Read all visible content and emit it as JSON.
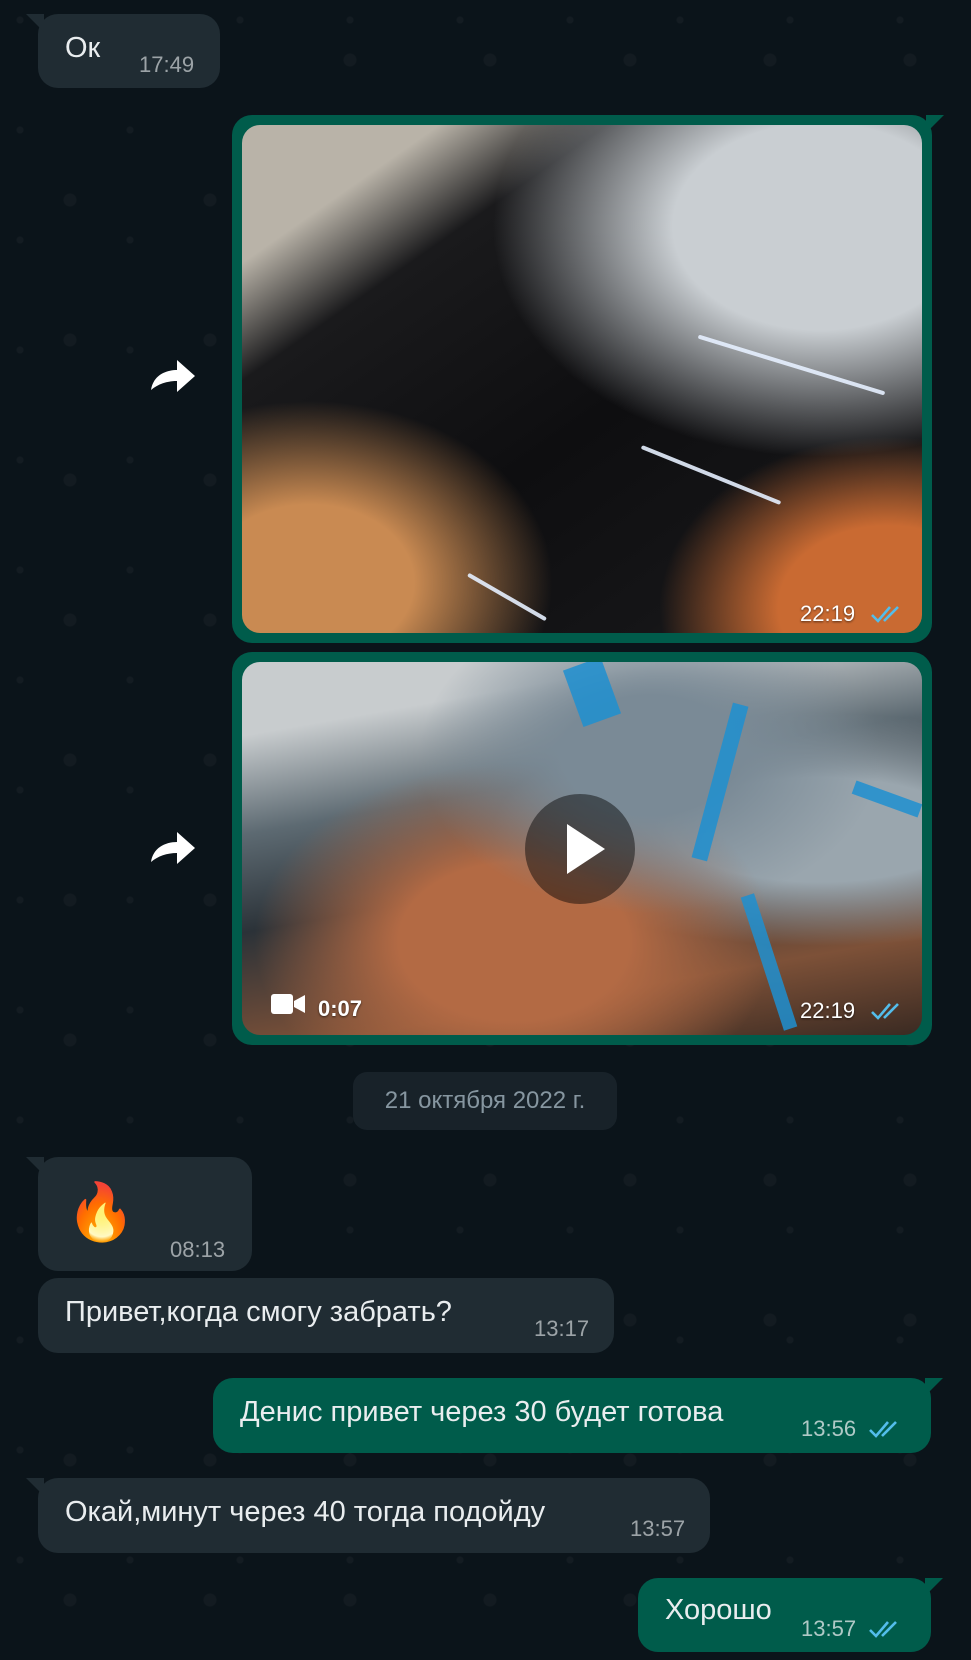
{
  "messages": [
    {
      "text": "Ок",
      "time": "17:49"
    },
    {
      "type": "photo",
      "time": "22:19"
    },
    {
      "type": "video",
      "duration": "0:07",
      "time": "22:19"
    },
    {
      "emoji": "🔥",
      "time": "08:13"
    },
    {
      "text": "Привет,когда смогу забрать?",
      "time": "13:17"
    },
    {
      "text": "Денис привет через 30 будет готова",
      "time": "13:56"
    },
    {
      "text": "Окай,минут через 40 тогда подойду",
      "time": "13:57"
    },
    {
      "text": "Хорошо",
      "time": "13:57"
    }
  ],
  "date_divider": "21 октября 2022 г.",
  "icons": {
    "forward": "forward-arrow-icon",
    "read": "double-check-icon",
    "video": "video-camera-icon",
    "play": "play-icon"
  },
  "colors": {
    "incoming": "#202c33",
    "outgoing": "#005c4b",
    "read_ticks": "#53bdeb",
    "background": "#0b141a"
  }
}
